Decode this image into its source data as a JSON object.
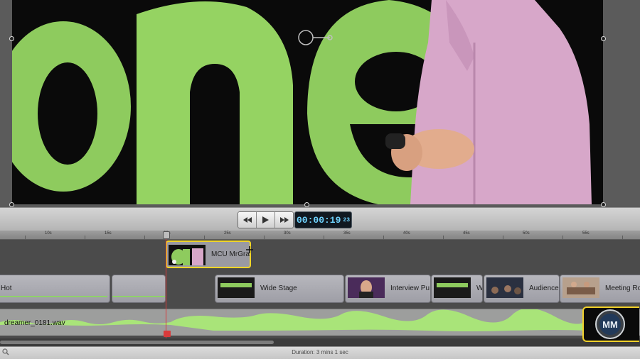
{
  "viewer": {
    "description_icon": "presenter-frame"
  },
  "transport": {
    "rewind_icon": "rewind-icon",
    "play_icon": "play-icon",
    "forward_icon": "fast-forward-icon",
    "timecode_main": "00:00:19",
    "timecode_frames": "23"
  },
  "ruler": {
    "ticks": [
      "10s",
      "15s",
      "20s",
      "25s",
      "30s",
      "35s",
      "40s",
      "45s",
      "50s",
      "55s"
    ]
  },
  "connected_clip": {
    "label": "MCU MrGra"
  },
  "storyline": {
    "clips": [
      {
        "label": "Hot"
      },
      {
        "label": ""
      },
      {
        "label": "Wide Stage"
      },
      {
        "label": "Interview Pu"
      },
      {
        "label": "W"
      },
      {
        "label": "Audience"
      },
      {
        "label": "Meeting Ro"
      }
    ]
  },
  "music": {
    "label": "dreamer_0181.wav"
  },
  "status": {
    "duration": "Duration: 3 mins 1 sec",
    "zoom_icon": "magnifier-icon"
  },
  "watermark": {
    "text": "MM"
  },
  "colors": {
    "selection": "#f0d528",
    "playhead": "#d93b3b",
    "timecode": "#6fd3ff",
    "waveform": "#9bdb68"
  }
}
